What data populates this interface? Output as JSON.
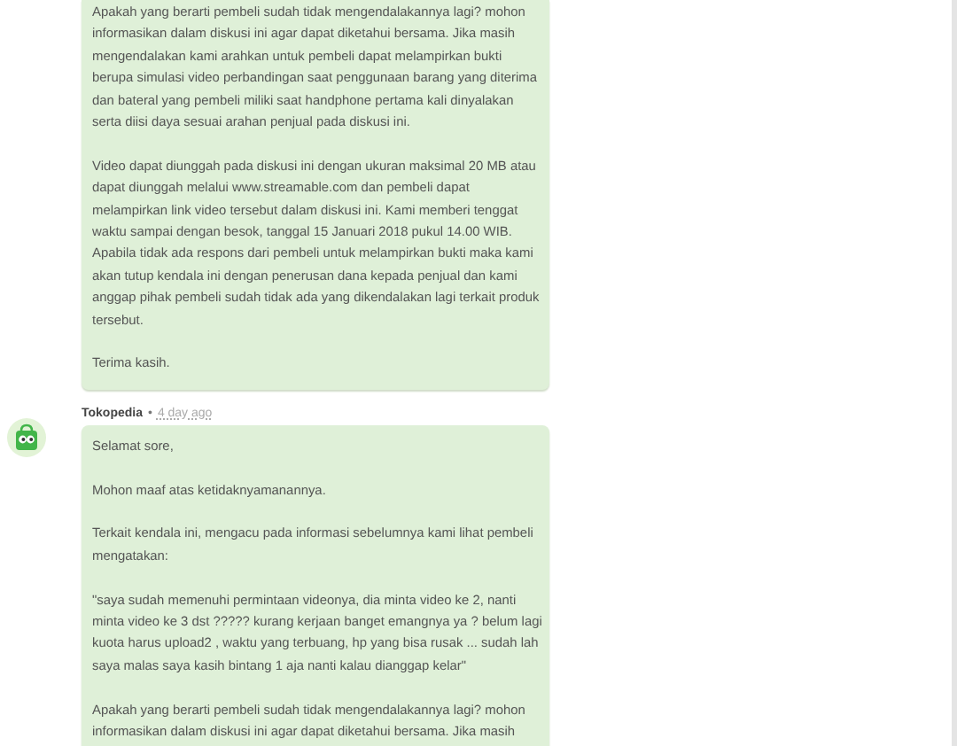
{
  "messages": [
    {
      "paragraphs": [
        "Apakah yang berarti pembeli sudah tidak mengendalakannya lagi? mohon informasikan dalam diskusi ini agar dapat diketahui bersama. Jika masih mengendalakan kami arahkan untuk pembeli dapat melampirkan bukti berupa simulasi video perbandingan saat penggunaan barang yang diterima dan bateral yang pembeli miliki saat handphone pertama kali dinyalakan serta diisi daya sesuai arahan penjual pada diskusi ini.",
        "Video dapat diunggah pada diskusi ini dengan ukuran maksimal 20 MB atau dapat diunggah melalui www.streamable.com dan pembeli dapat melampirkan link video tersebut dalam diskusi ini. Kami memberi tenggat waktu sampai dengan besok, tanggal 15 Januari 2018 pukul 14.00 WIB. Apabila tidak ada respons dari pembeli untuk melampirkan bukti maka kami akan tutup kendala ini dengan penerusan dana kepada penjual dan kami anggap pihak pembeli sudah tidak ada yang dikendalakan lagi terkait produk tersebut.",
        "Terima kasih."
      ]
    },
    {
      "author": "Tokopedia",
      "separator": "•",
      "time": "4 day ago",
      "paragraphs": [
        "Selamat sore,",
        "Mohon maaf atas ketidaknyamanannya.",
        "Terkait kendala ini, mengacu pada informasi sebelumnya kami lihat pembeli mengatakan:",
        "\"saya sudah memenuhi permintaan videonya, dia minta video ke 2, nanti minta video ke 3 dst ????? kurang kerjaan banget emangnya ya ? belum lagi kuota harus upload2 , waktu yang terbuang, hp yang bisa rusak ... sudah lah saya malas saya kasih bintang 1 aja nanti kalau dianggap kelar\"",
        "Apakah yang berarti pembeli sudah tidak mengendalakannya lagi? mohon informasikan dalam diskusi ini agar dapat diketahui bersama. Jika masih"
      ]
    }
  ]
}
